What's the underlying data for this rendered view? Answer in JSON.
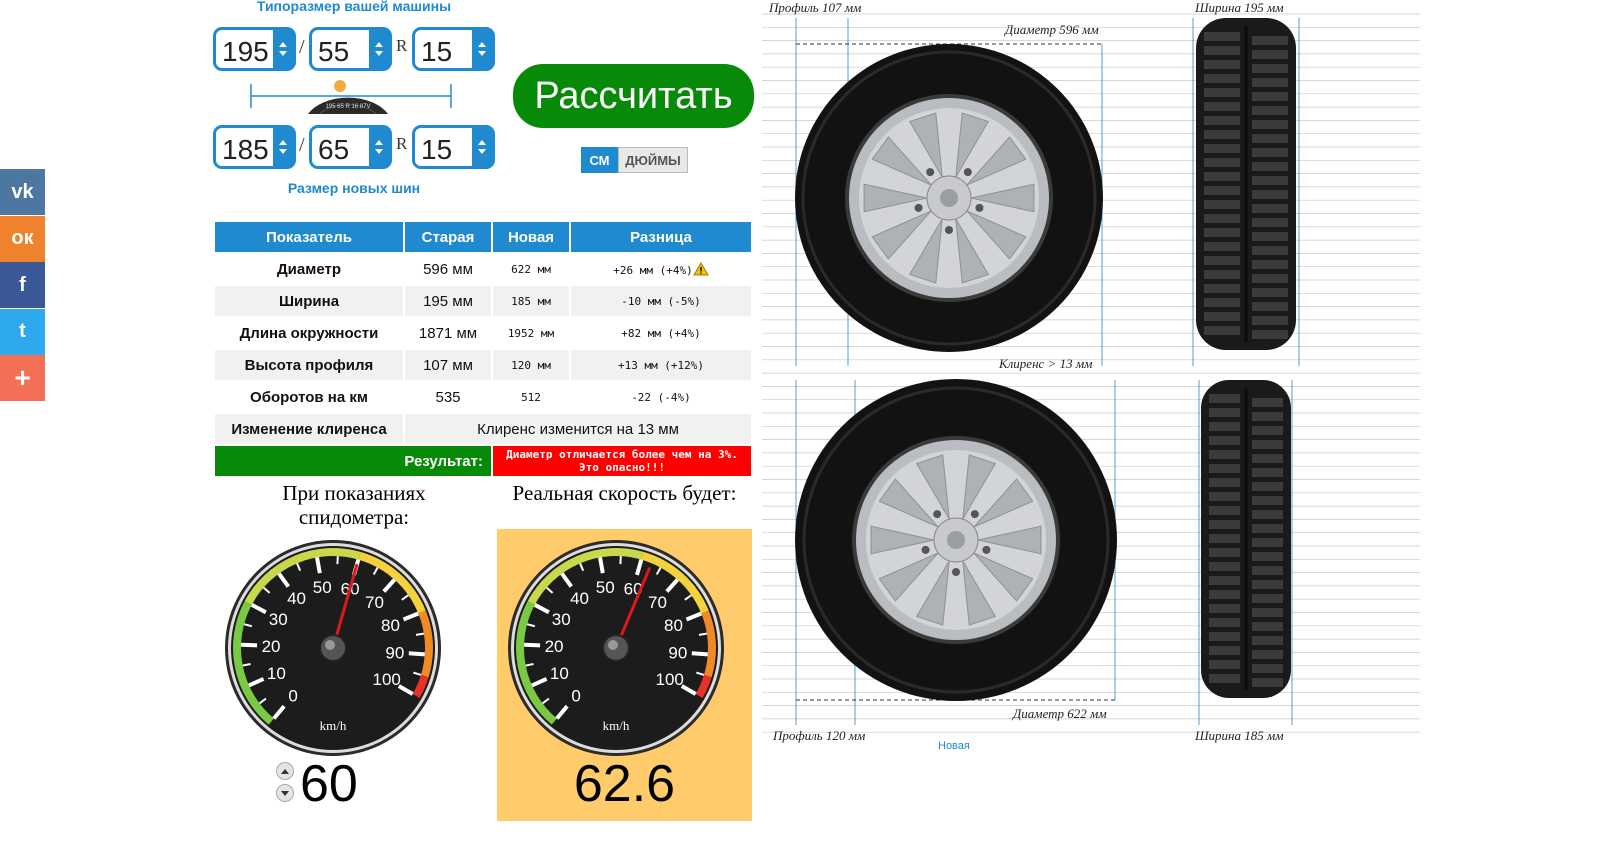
{
  "social": [
    {
      "name": "vk-button",
      "icon": "vk-icon",
      "glyph": "vk",
      "color": "#4d76a1"
    },
    {
      "name": "ok-button",
      "icon": "odnoklassniki-icon",
      "glyph": "ок",
      "color": "#f0822d"
    },
    {
      "name": "facebook-button",
      "icon": "facebook-icon",
      "glyph": "f",
      "color": "#3b5998"
    },
    {
      "name": "twitter-button",
      "icon": "twitter-icon",
      "glyph": "t",
      "color": "#2ea9ee"
    },
    {
      "name": "more-button",
      "icon": "plus-icon",
      "glyph": "+",
      "color": "#f36f55"
    }
  ],
  "form": {
    "top_caption": "Типоразмер вашей машины",
    "old": {
      "width": "195",
      "profile": "55",
      "radius": "15"
    },
    "new": {
      "width": "185",
      "profile": "65",
      "radius": "15"
    },
    "slash": "/",
    "r": "R",
    "bottom_caption": "Размер новых шин",
    "badge_text": "195 65 R 16 87V"
  },
  "calculate_label": "Рассчитать",
  "units": {
    "cm": "СМ",
    "inches": "ДЮЙМЫ",
    "active": "cm"
  },
  "table": {
    "headers": [
      "Показатель",
      "Старая",
      "Новая",
      "Разница"
    ],
    "rows": [
      {
        "label": "Диаметр",
        "old": "596 мм",
        "new": "622 мм",
        "diff": "+26 мм (+4%)",
        "warn": true
      },
      {
        "label": "Ширина",
        "old": "195 мм",
        "new": "185 мм",
        "diff": "-10 мм (-5%)",
        "warn": false
      },
      {
        "label": "Длина окружности",
        "old": "1871 мм",
        "new": "1952 мм",
        "diff": "+82 мм (+4%)",
        "warn": false
      },
      {
        "label": "Высота профиля",
        "old": "107 мм",
        "new": "120 мм",
        "diff": "+13 мм (+12%)",
        "warn": false
      },
      {
        "label": "Оборотов на км",
        "old": "535",
        "new": "512",
        "diff": "-22 (-4%)",
        "warn": false
      }
    ],
    "clearance_label": "Изменение клиренса",
    "clearance_value": "Клиренс изменится на 13 мм",
    "result_label": "Результат:",
    "result_value": "Диаметр отличается более чем на 3%.\nЭто опасно!!!",
    "colors": {
      "header": "#1f8ad0",
      "result_ok": "#078a07",
      "result_bad": "#ff0000"
    }
  },
  "speed": {
    "left_title": "При показаниях спидометра:",
    "right_title": "Реальная скорость будет:",
    "unit": "km/h",
    "ticks": [
      "0",
      "10",
      "20",
      "30",
      "40",
      "50",
      "60",
      "70",
      "80",
      "90",
      "100"
    ],
    "speedometer_value": 60,
    "real_value": "62.6",
    "real_numeric": 62.6,
    "input_value": "60"
  },
  "tires": {
    "old_profile": "Профиль 107 мм",
    "old_width": "Ширина 195 мм",
    "old_diameter": "Диаметр 596 мм",
    "clearance": "Клиренс > 13 мм",
    "new_diameter": "Диаметр 622 мм",
    "new_profile": "Профиль 120 мм",
    "new_width": "Ширина 185 мм",
    "new_caption": "Новая"
  }
}
